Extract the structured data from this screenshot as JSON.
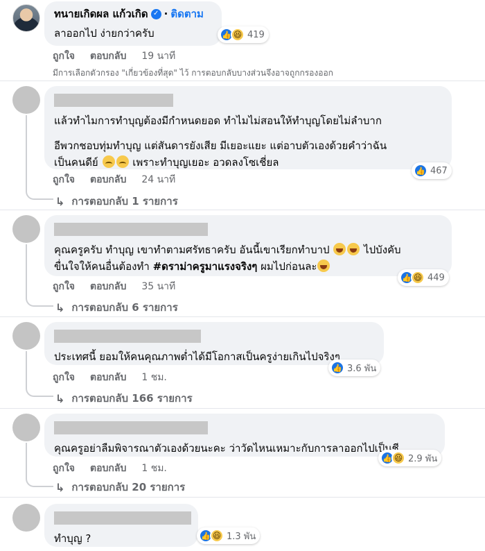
{
  "top_comment": {
    "author": "ทนายเกิดผล แก้วเกิด",
    "separator": "·",
    "follow_label": "ติดตาม",
    "text": "ลาออกไป ง่ายกว่าครับ",
    "reaction_count": "419",
    "like_label": "ถูกใจ",
    "reply_label": "ตอบกลับ",
    "time": "19 นาที",
    "filter_note": "มีการเลือกตัวกรอง \"เกี่ยวข้องที่สุด\" ไว้ การตอบกลับบางส่วนจึงอาจถูกกรองออก"
  },
  "comments": [
    {
      "paragraph1": "แล้วทำไมการทำบุญต้องมีกำหนดยอด ทำไมไม่สอนให้ทำบุญโดยไม่ลำบาก",
      "paragraph2_line1": "อีพวกชอบทุ่มทำบุญ แต่สันดารยังเสีย มีเยอะแยะ แต่อาบตัวเองด้วยคำว่าฉัน",
      "paragraph2_line2a": "เป็นคนดีย์",
      "paragraph2_line2b": "เพราะทำบุญเยอะ อวดลงโซเชี่ยล",
      "reaction_count": "467",
      "like_label": "ถูกใจ",
      "reply_label": "ตอบกลับ",
      "time": "24 นาที",
      "replies_label": "การตอบกลับ 1 รายการ"
    },
    {
      "line1a": "คุณครูครับ ทำบุญ เขาทำตามศรัทธาครับ อันนี้เขาเรียกทำบาป",
      "line1b": "ไปบังคับ",
      "line2a": "ขื่นใจให้คนอื่นต้องทำ",
      "line2_tag": "#ดราม่าครูมาแรงจริงๆ",
      "line2b": "ผมไปก่อนละ",
      "reaction_count": "449",
      "like_label": "ถูกใจ",
      "reply_label": "ตอบกลับ",
      "time": "35 นาที",
      "replies_label": "การตอบกลับ 6 รายการ"
    },
    {
      "text": "ประเทศนี้ ยอมให้คนคุณภาพต่ำได้มีโอกาสเป็นครูง่ายเกินไปจริงๆ",
      "reaction_count": "3.6 พัน",
      "like_label": "ถูกใจ",
      "reply_label": "ตอบกลับ",
      "time": "1 ชม.",
      "replies_label": "การตอบกลับ 166 รายการ"
    },
    {
      "text": "คุณครูอย่าลืมพิจารณาตัวเองด้วยนะคะ ว่าวัดไหนเหมาะกับการลาออกไปเป็นชี",
      "reaction_count": "2.9 พัน",
      "like_label": "ถูกใจ",
      "reply_label": "ตอบกลับ",
      "time": "1 ชม.",
      "replies_label": "การตอบกลับ 20 รายการ"
    },
    {
      "text": "ทำบุญ ?",
      "reaction_count": "1.3 พัน"
    }
  ],
  "icons": {
    "like": "like-reaction-icon",
    "haha": "haha-reaction-icon",
    "verified": "verified-badge-icon",
    "reply_arrow": "reply-arrow-icon"
  },
  "colors": {
    "accent": "#1877f2",
    "bubble": "#f0f2f5",
    "muted": "#65676b"
  }
}
